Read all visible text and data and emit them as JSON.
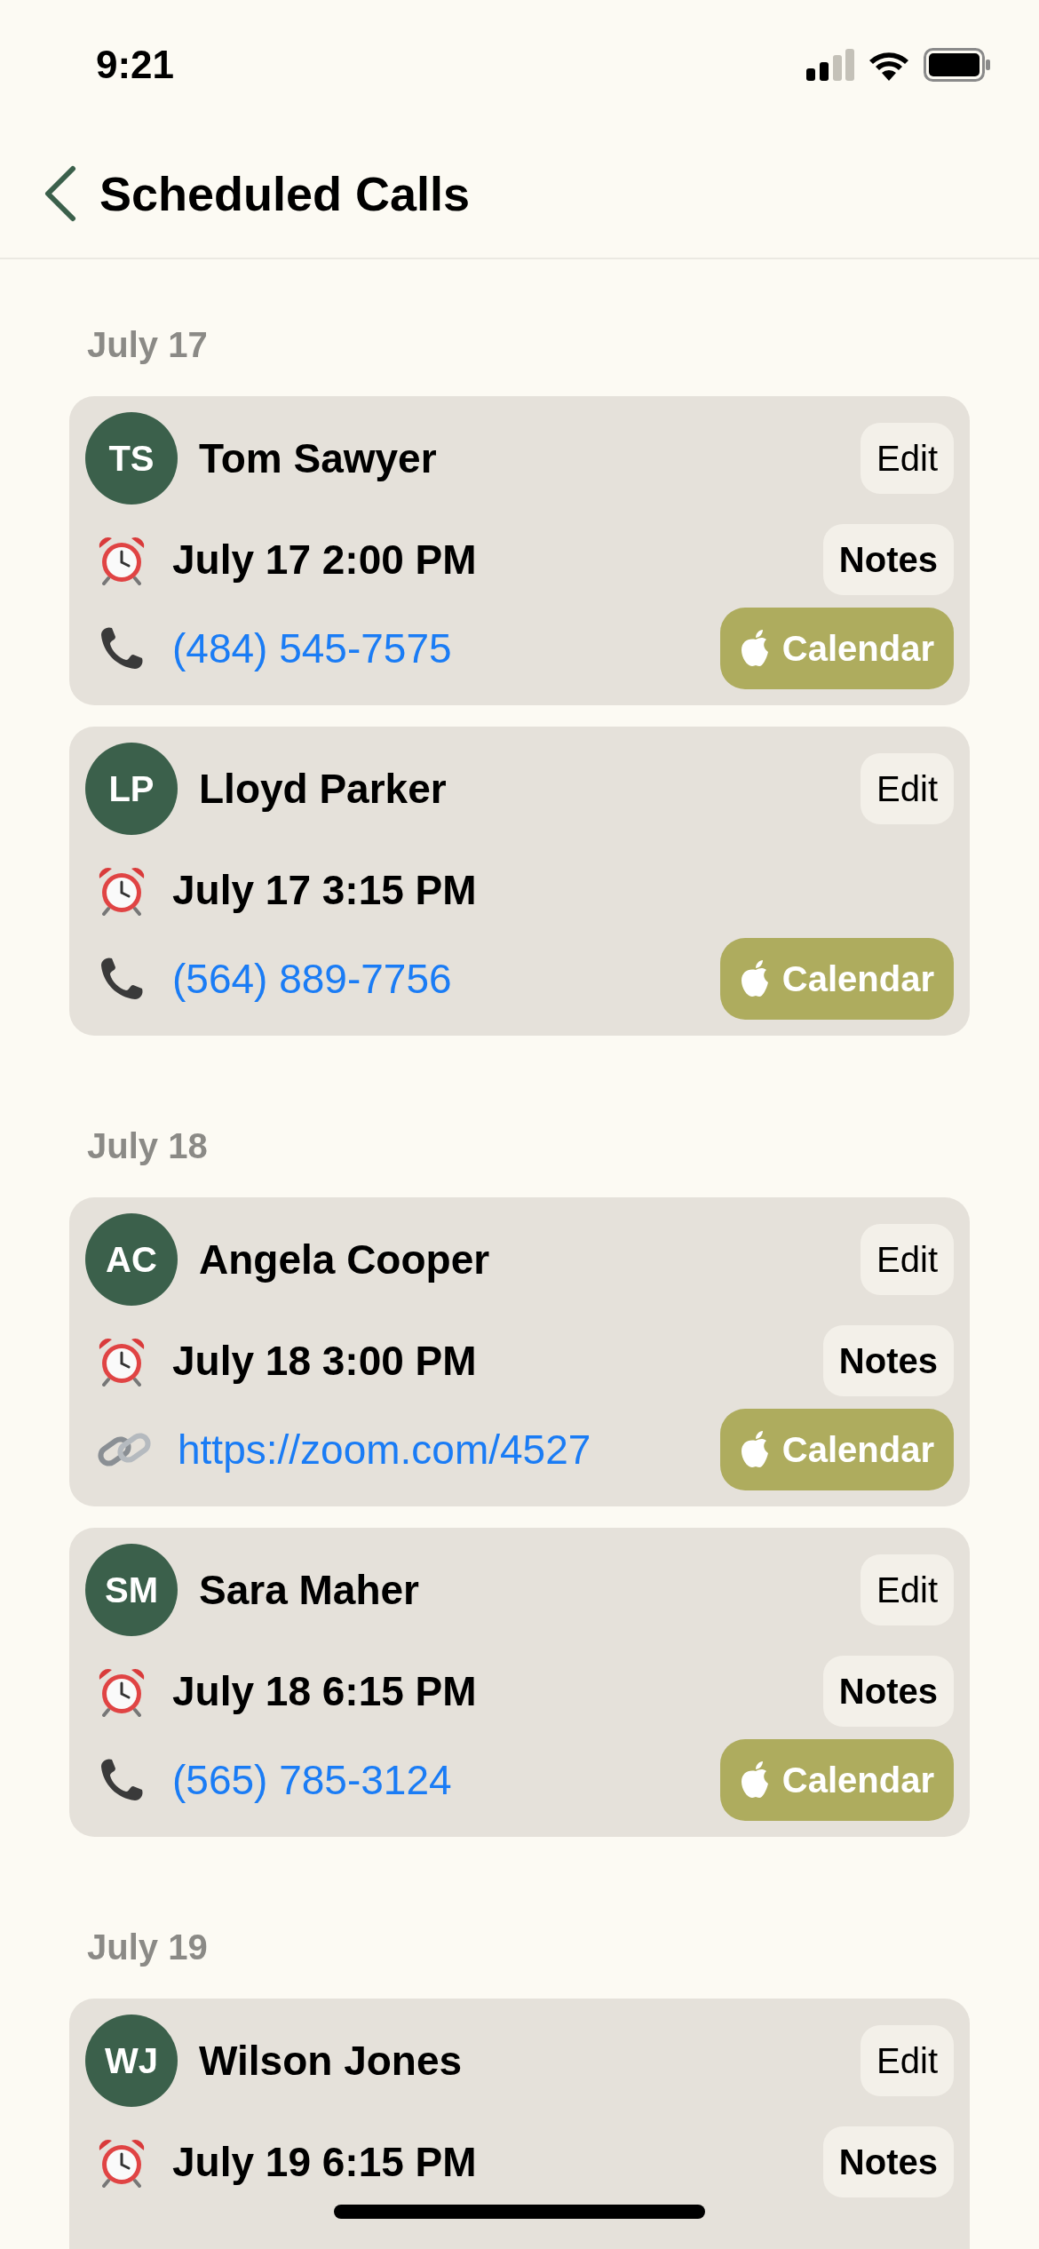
{
  "status_bar": {
    "time": "9:21"
  },
  "nav": {
    "title": "Scheduled Calls"
  },
  "sections": [
    {
      "date": "July 17",
      "calls": [
        {
          "initials": "TS",
          "name": "Tom Sawyer",
          "edit": "Edit",
          "time": "July 17 2:00 PM",
          "notes": "Notes",
          "contact": {
            "kind": "phone",
            "text": "(484) 545-7575"
          },
          "calendar": "Calendar"
        },
        {
          "initials": "LP",
          "name": "Lloyd Parker",
          "edit": "Edit",
          "time": "July 17 3:15 PM",
          "contact": {
            "kind": "phone",
            "text": "(564) 889-7756"
          },
          "calendar": "Calendar"
        }
      ]
    },
    {
      "date": "July 18",
      "calls": [
        {
          "initials": "AC",
          "name": "Angela Cooper",
          "edit": "Edit",
          "time": "July 18 3:00 PM",
          "notes": "Notes",
          "contact": {
            "kind": "link",
            "text": "https://zoom.com/4527"
          },
          "calendar": "Calendar"
        },
        {
          "initials": "SM",
          "name": "Sara Maher",
          "edit": "Edit",
          "time": "July 18 6:15 PM",
          "notes": "Notes",
          "contact": {
            "kind": "phone",
            "text": "(565) 785-3124"
          },
          "calendar": "Calendar"
        }
      ]
    },
    {
      "date": "July 19",
      "calls": [
        {
          "initials": "WJ",
          "name": "Wilson Jones",
          "edit": "Edit",
          "time": "July 19 6:15 PM",
          "notes": "Notes"
        }
      ]
    }
  ]
}
